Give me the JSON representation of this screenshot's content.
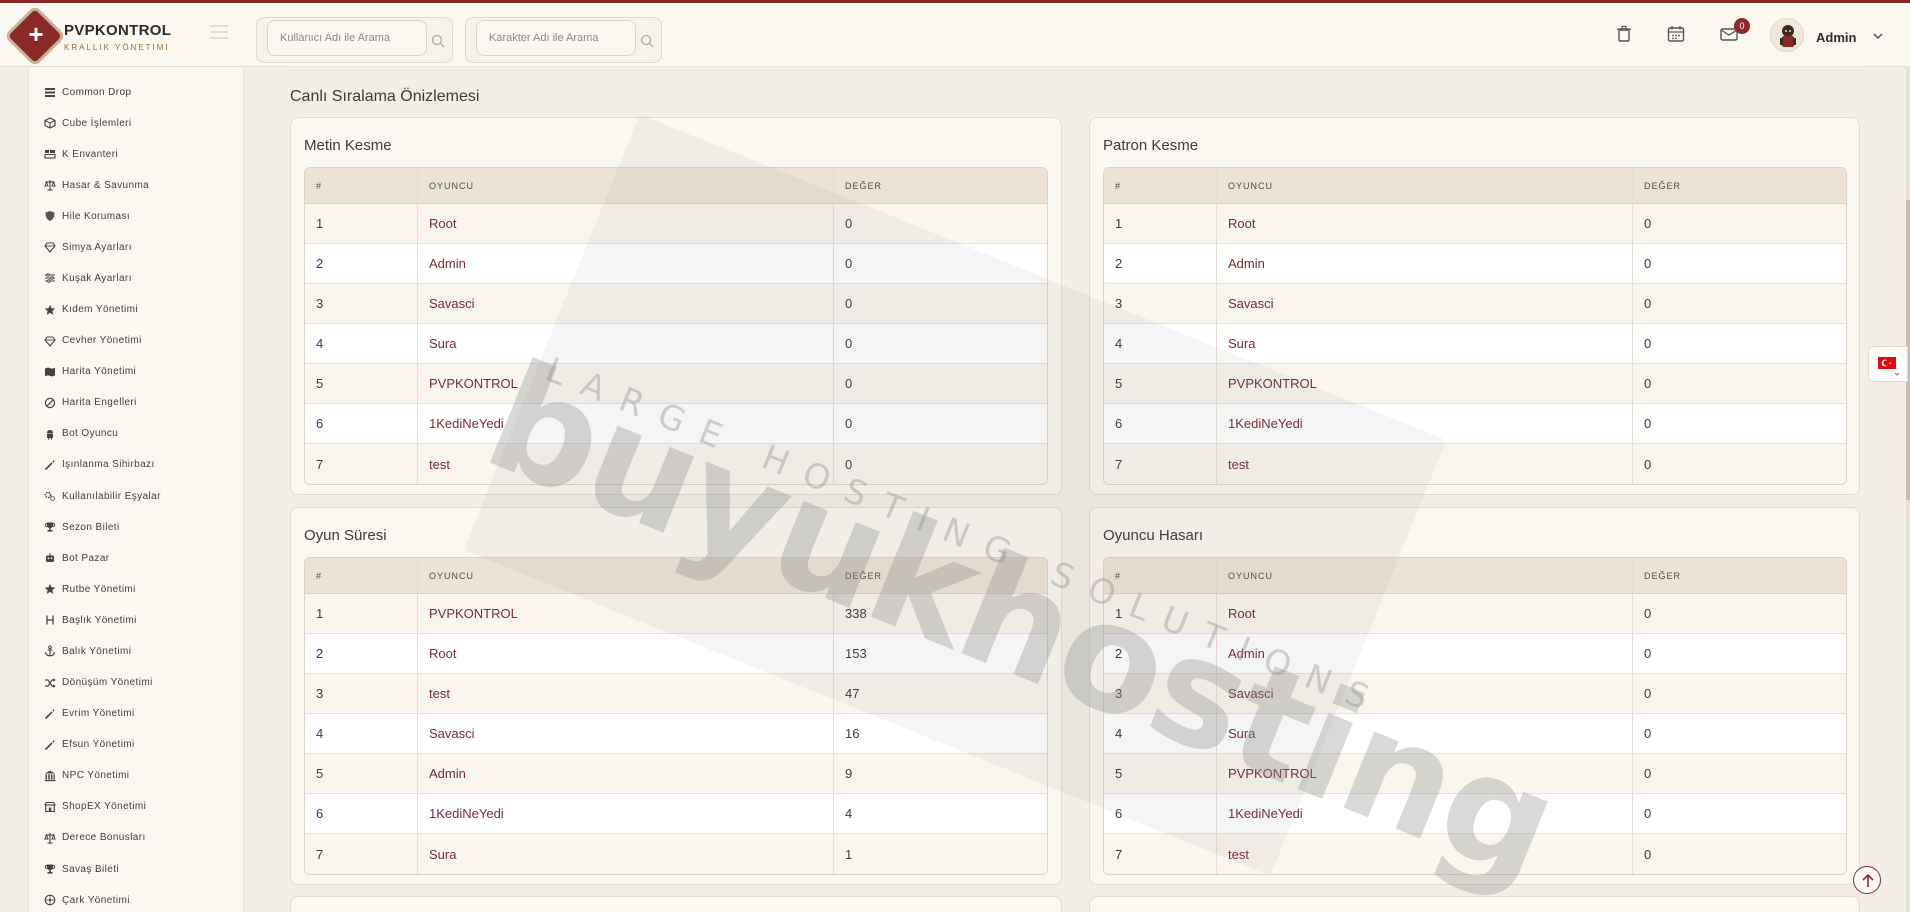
{
  "brand": {
    "name": "PVPKONTROL",
    "subtitle": "KRALLIK YÖNETİMİ"
  },
  "header": {
    "search_user_placeholder": "Kullanıcı Adı ile Arama",
    "search_char_placeholder": "Karakter Adı ile Arama",
    "notification_count": "0",
    "user_name": "Admin"
  },
  "sidebar": {
    "items": [
      {
        "label": "Common Drop",
        "icon": "list-icon"
      },
      {
        "label": "Cube İşlemleri",
        "icon": "cube-icon"
      },
      {
        "label": "K Envanteri",
        "icon": "inventory-icon"
      },
      {
        "label": "Hasar & Savunma",
        "icon": "scale-icon"
      },
      {
        "label": "Hile Koruması",
        "icon": "shield-icon"
      },
      {
        "label": "Simya Ayarları",
        "icon": "gem-icon"
      },
      {
        "label": "Kuşak Ayarları",
        "icon": "sliders-icon"
      },
      {
        "label": "Kıdem Yönetimi",
        "icon": "star-icon"
      },
      {
        "label": "Cevher Yönetimi",
        "icon": "gem-icon"
      },
      {
        "label": "Harita Yönetimi",
        "icon": "map-icon"
      },
      {
        "label": "Harita Engelleri",
        "icon": "ban-icon"
      },
      {
        "label": "Bot Oyuncu",
        "icon": "android-icon"
      },
      {
        "label": "Işınlanma Sihirbazı",
        "icon": "wand-icon"
      },
      {
        "label": "Kullanılabilir Eşyalar",
        "icon": "gears-icon"
      },
      {
        "label": "Sezon Bileti",
        "icon": "trophy-icon"
      },
      {
        "label": "Bot Pazar",
        "icon": "robot-icon"
      },
      {
        "label": "Rutbe Yönetimi",
        "icon": "star-icon"
      },
      {
        "label": "Başlık Yönetimi",
        "icon": "heading-icon"
      },
      {
        "label": "Balık Yönetimi",
        "icon": "anchor-icon"
      },
      {
        "label": "Dönüşüm Yönetimi",
        "icon": "shuffle-icon"
      },
      {
        "label": "Evrim Yönetimi",
        "icon": "wand-icon"
      },
      {
        "label": "Efsun Yönetimi",
        "icon": "wand-icon"
      },
      {
        "label": "NPC Yönetimi",
        "icon": "building-icon"
      },
      {
        "label": "ShopEX Yönetimi",
        "icon": "shop-icon"
      },
      {
        "label": "Derece Bonusları",
        "icon": "scale-icon"
      },
      {
        "label": "Savaş Bileti",
        "icon": "trophy-icon"
      },
      {
        "label": "Çark Yönetimi",
        "icon": "wheel-icon"
      }
    ]
  },
  "main": {
    "section_title": "Canlı Sıralama Önizlemesi",
    "columns": [
      "#",
      "OYUNCU",
      "DEĞER"
    ],
    "tables": [
      {
        "title": "Metin Kesme",
        "rows": [
          [
            "1",
            "Root",
            "0"
          ],
          [
            "2",
            "Admin",
            "0"
          ],
          [
            "3",
            "Savasci",
            "0"
          ],
          [
            "4",
            "Sura",
            "0"
          ],
          [
            "5",
            "PVPKONTROL",
            "0"
          ],
          [
            "6",
            "1KediNeYedi",
            "0"
          ],
          [
            "7",
            "test",
            "0"
          ]
        ]
      },
      {
        "title": "Patron Kesme",
        "rows": [
          [
            "1",
            "Root",
            "0"
          ],
          [
            "2",
            "Admin",
            "0"
          ],
          [
            "3",
            "Savasci",
            "0"
          ],
          [
            "4",
            "Sura",
            "0"
          ],
          [
            "5",
            "PVPKONTROL",
            "0"
          ],
          [
            "6",
            "1KediNeYedi",
            "0"
          ],
          [
            "7",
            "test",
            "0"
          ]
        ]
      },
      {
        "title": "Oyun Süresi",
        "rows": [
          [
            "1",
            "PVPKONTROL",
            "338"
          ],
          [
            "2",
            "Root",
            "153"
          ],
          [
            "3",
            "test",
            "47"
          ],
          [
            "4",
            "Savasci",
            "16"
          ],
          [
            "5",
            "Admin",
            "9"
          ],
          [
            "6",
            "1KediNeYedi",
            "4"
          ],
          [
            "7",
            "Sura",
            "1"
          ]
        ]
      },
      {
        "title": "Oyuncu Hasarı",
        "rows": [
          [
            "1",
            "Root",
            "0"
          ],
          [
            "2",
            "Admin",
            "0"
          ],
          [
            "3",
            "Savasci",
            "0"
          ],
          [
            "4",
            "Sura",
            "0"
          ],
          [
            "5",
            "PVPKONTROL",
            "0"
          ],
          [
            "6",
            "1KediNeYedi",
            "0"
          ],
          [
            "7",
            "test",
            "0"
          ]
        ]
      }
    ]
  },
  "watermark": {
    "main": "buyukhosting",
    "sub": "LARGE HOSTING SOLUTIONS"
  },
  "colors": {
    "accent": "#8c2a2a",
    "player_link": "#7a2b35",
    "background": "#f3efe6"
  }
}
